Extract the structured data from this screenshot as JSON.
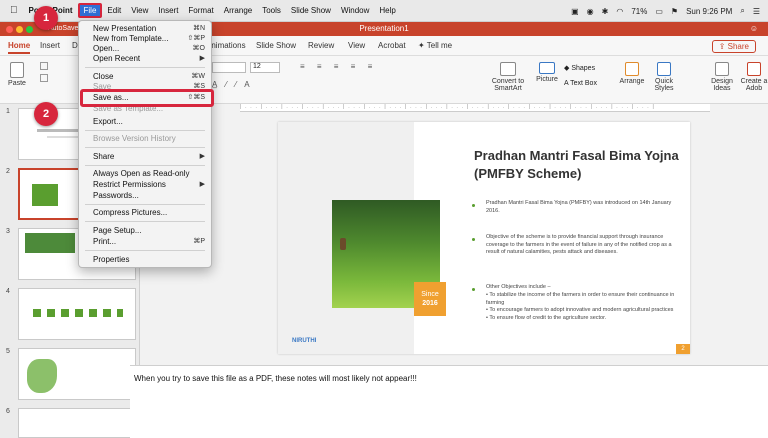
{
  "menubar": {
    "apple": "",
    "app": "PowerPoint",
    "file": "File",
    "items": [
      "Edit",
      "View",
      "Insert",
      "Format",
      "Arrange",
      "Tools",
      "Slide Show",
      "Window",
      "Help"
    ],
    "battery": "71%",
    "clock": "Sun 9:26 PM"
  },
  "titlebar": {
    "autosave": "AutoSave",
    "title": "Presentation1"
  },
  "ribbon_tabs": [
    "Home",
    "Insert",
    "D",
    "Animations",
    "Slide Show",
    "Review",
    "View",
    "Acrobat",
    "Tell me"
  ],
  "share": "Share",
  "ribbon": {
    "paste": "Paste",
    "font_size": "12",
    "convert": "Convert to SmartArt",
    "picture": "Picture",
    "shapes": "Shapes",
    "textbox": "Text Box",
    "arrange": "Arrange",
    "quick_styles": "Quick Styles",
    "design_ideas": "Design Ideas",
    "create_adobe": "Create a Adob"
  },
  "file_menu": {
    "items": [
      {
        "label": "New Presentation",
        "shortcut": "⌘N"
      },
      {
        "label": "New from Template...",
        "shortcut": "⇧⌘P"
      },
      {
        "label": "Open...",
        "shortcut": "⌘O"
      },
      {
        "label": "Open Recent",
        "shortcut": "▶"
      },
      {
        "label": "Close",
        "shortcut": "⌘W"
      },
      {
        "label": "Save",
        "shortcut": "⌘S"
      },
      {
        "label": "Save as...",
        "shortcut": "⇧⌘S"
      },
      {
        "label": "Save as Template...",
        "shortcut": ""
      },
      {
        "label": "Export...",
        "shortcut": ""
      },
      {
        "label": "Browse Version History",
        "shortcut": ""
      },
      {
        "label": "Share",
        "shortcut": "▶"
      },
      {
        "label": "Always Open as Read-only",
        "shortcut": ""
      },
      {
        "label": "Restrict Permissions",
        "shortcut": "▶"
      },
      {
        "label": "Passwords...",
        "shortcut": ""
      },
      {
        "label": "Compress Pictures...",
        "shortcut": ""
      },
      {
        "label": "Page Setup...",
        "shortcut": ""
      },
      {
        "label": "Print...",
        "shortcut": "⌘P"
      },
      {
        "label": "Properties",
        "shortcut": ""
      }
    ]
  },
  "badges": [
    "1",
    "2"
  ],
  "thumb_numbers": [
    "1",
    "2",
    "3",
    "4",
    "5",
    "6"
  ],
  "slide": {
    "title_line1": "Pradhan Mantri Fasal Bima Yojna",
    "title_line2": "(PMFBY Scheme)",
    "since_label": "Since",
    "since_year": "2016",
    "logo": "NIRUTHI",
    "bullet1": "Pradhan Mantri Fasal Bima Yojna (PMFBY) was introduced on 14th January 2016.",
    "bullet2": "Objective of the scheme is to provide financial support through insurance coverage to the farmers in the event of failure in any of the notified crop as a result of natural calamities, pests attack and diseases.",
    "bullet3_head": "Other Objectives include –",
    "sub_bullets": [
      "To stabilize the income of the farmers in order to ensure their continuance in farming",
      "To encourage farmers to adopt innovative and modern agricultural practices",
      "To ensure flow of credit to the agriculture sector."
    ],
    "page_number": "2"
  },
  "notes": "When you try to save this file as a PDF, these notes will most likely not appear!!!",
  "colors": {
    "accent": "#c8432b",
    "highlight": "#d7263d",
    "menu_blue": "#2f6fd6",
    "green": "#5a9e2f",
    "orange": "#f0a030"
  }
}
